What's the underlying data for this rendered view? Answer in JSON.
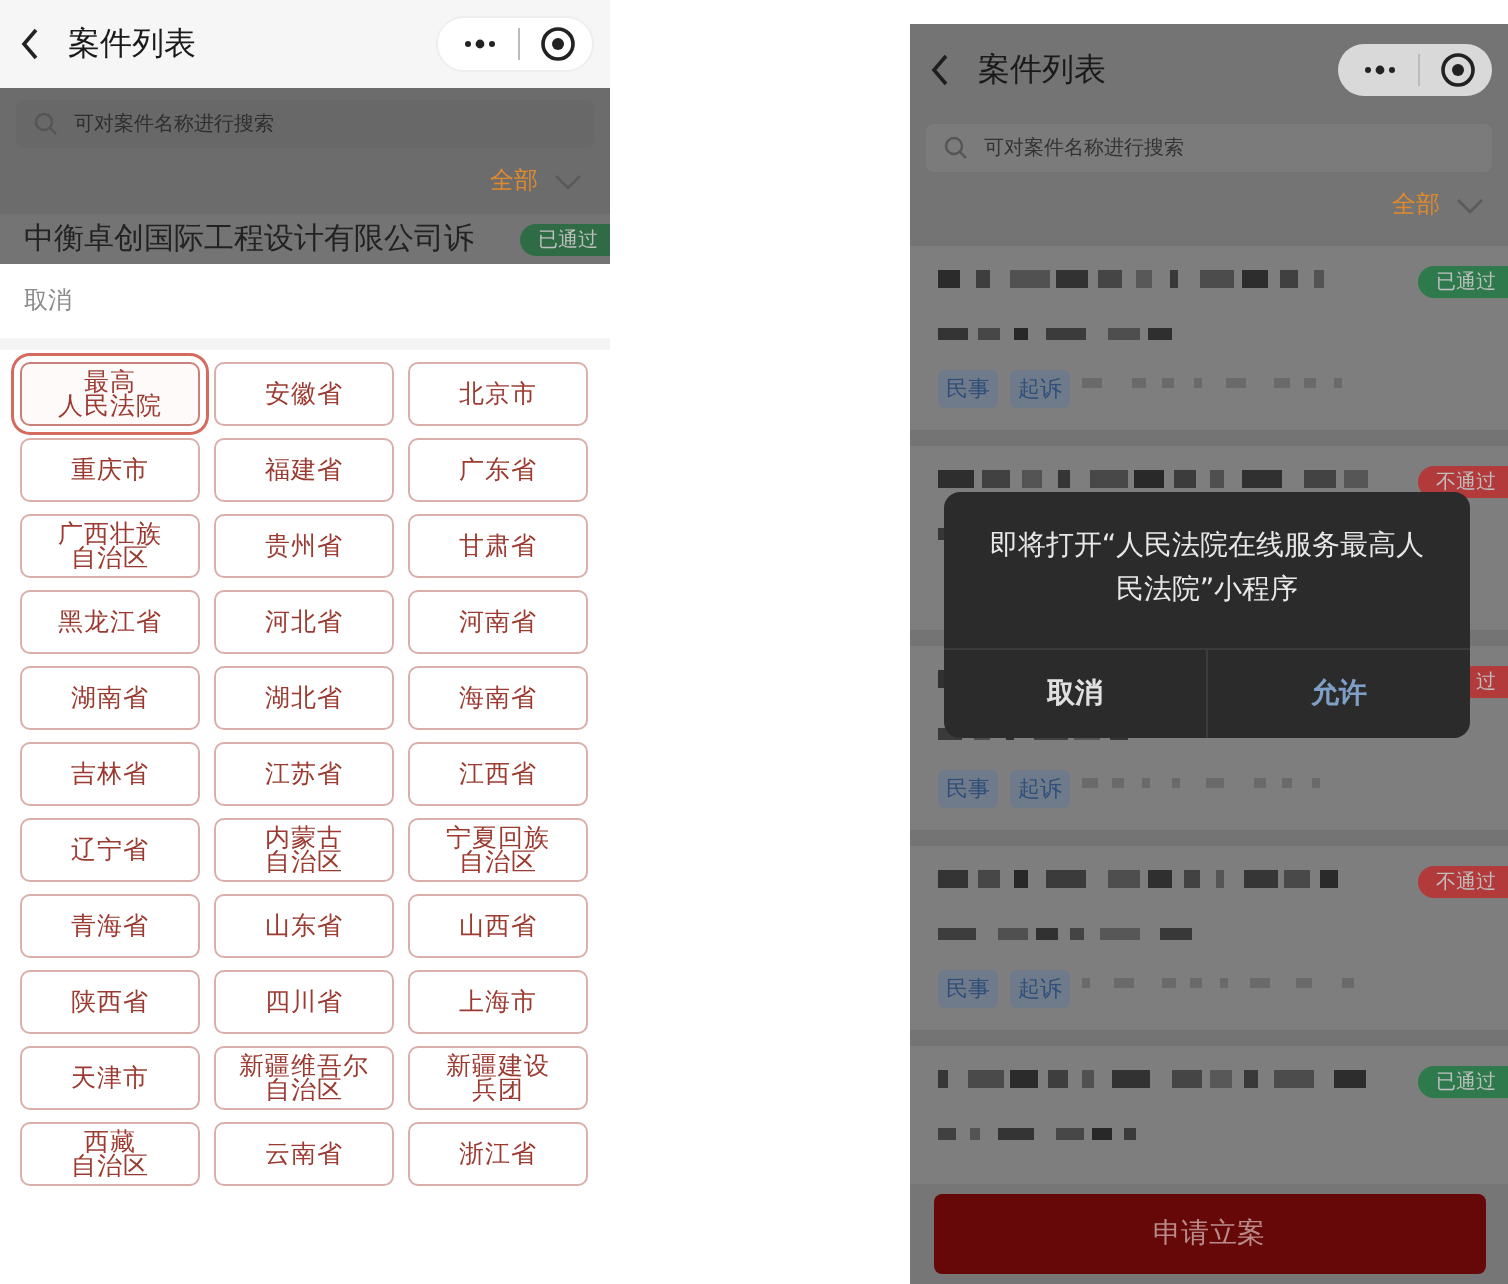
{
  "left_screen": {
    "nav": {
      "title": "案件列表"
    },
    "search": {
      "placeholder": "可对案件名称进行搜索"
    },
    "filter": "全部",
    "partial_case": {
      "title": "中衡卓创国际工程设计有限公司诉",
      "status": "已通过",
      "color": "#2f6b45"
    },
    "region_sheet": {
      "cancel": "取消",
      "regions": [
        {
          "lines": [
            "最高",
            "人民法院"
          ],
          "selected": true
        },
        {
          "label": "安徽省",
          "selected": false
        },
        {
          "label": "北京市",
          "selected": false
        },
        {
          "label": "重庆市",
          "selected": false
        },
        {
          "label": "福建省",
          "selected": false
        },
        {
          "label": "广东省",
          "selected": false
        },
        {
          "lines": [
            "广西壮族",
            "自治区"
          ],
          "selected": false
        },
        {
          "label": "贵州省",
          "selected": false
        },
        {
          "label": "甘肃省",
          "selected": false
        },
        {
          "label": "黑龙江省",
          "selected": false
        },
        {
          "label": "河北省",
          "selected": false
        },
        {
          "label": "河南省",
          "selected": false
        },
        {
          "label": "湖南省",
          "selected": false
        },
        {
          "label": "湖北省",
          "selected": false
        },
        {
          "label": "海南省",
          "selected": false
        },
        {
          "label": "吉林省",
          "selected": false
        },
        {
          "label": "江苏省",
          "selected": false
        },
        {
          "label": "江西省",
          "selected": false
        },
        {
          "label": "辽宁省",
          "selected": false
        },
        {
          "lines": [
            "内蒙古",
            "自治区"
          ],
          "selected": false
        },
        {
          "lines": [
            "宁夏回族",
            "自治区"
          ],
          "selected": false
        },
        {
          "label": "青海省",
          "selected": false
        },
        {
          "label": "山东省",
          "selected": false
        },
        {
          "label": "山西省",
          "selected": false
        },
        {
          "label": "陕西省",
          "selected": false
        },
        {
          "label": "四川省",
          "selected": false
        },
        {
          "label": "上海市",
          "selected": false
        },
        {
          "label": "天津市",
          "selected": false
        },
        {
          "lines": [
            "新疆维吾尔",
            "自治区"
          ],
          "selected": false
        },
        {
          "lines": [
            "新疆建设",
            "兵团"
          ],
          "selected": false
        },
        {
          "lines": [
            "西藏",
            "自治区"
          ],
          "selected": false
        },
        {
          "label": "云南省",
          "selected": false
        },
        {
          "label": "浙江省",
          "selected": false
        }
      ]
    }
  },
  "right_screen": {
    "nav": {
      "title": "案件列表"
    },
    "search": {
      "placeholder": "可对案件名称进行搜索"
    },
    "filter": "全部",
    "cases": [
      {
        "status": "已通过",
        "color": "#2e7a4c",
        "tags": [
          "民事",
          "起诉"
        ]
      },
      {
        "status": "不通过",
        "color": "#b23a3a"
      },
      {
        "status": "过",
        "color": "#b23a3a",
        "tags": [
          "民事",
          "起诉"
        ]
      },
      {
        "status": "不通过",
        "color": "#b23a3a",
        "tags": [
          "民事",
          "起诉"
        ]
      },
      {
        "status": "已通过",
        "color": "#2e7a4c"
      }
    ],
    "dialog": {
      "message": "即将打开“人民法院在线服务最高人民法院”小程序",
      "buttons": [
        {
          "label": "取消",
          "kind": "cancel"
        },
        {
          "label": "允许",
          "kind": "confirm"
        }
      ]
    },
    "primary_button": "申请立案"
  }
}
